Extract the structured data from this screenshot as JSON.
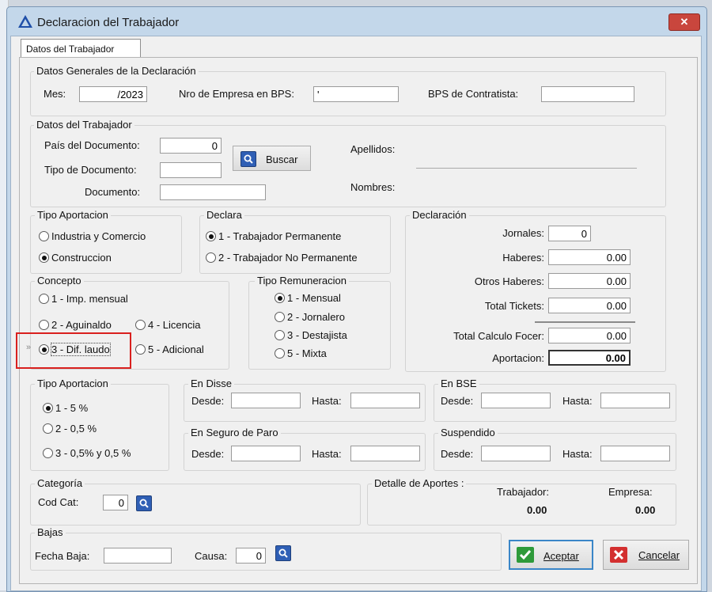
{
  "window": {
    "title": "Declaracion del Trabajador",
    "close_glyph": "✕"
  },
  "tab": {
    "label": "Datos del Trabajador"
  },
  "generales": {
    "title": "Datos Generales de la Declaración",
    "mes_label": "Mes:",
    "mes_value": "/2023",
    "nro_empresa_label": "Nro de Empresa en BPS:",
    "nro_empresa_value": "'",
    "bps_contratista_label": "BPS de Contratista:",
    "bps_contratista_value": ""
  },
  "trabajador": {
    "title": "Datos del Trabajador",
    "pais_label": "País del Documento:",
    "pais_value": "0",
    "tipo_doc_label": "Tipo de Documento:",
    "tipo_doc_value": "",
    "documento_label": "Documento:",
    "documento_value": "",
    "buscar_label": "Buscar",
    "apellidos_label": "Apellidos:",
    "nombres_label": "Nombres:"
  },
  "tipo_aportacion_1": {
    "title": "Tipo Aportacion",
    "options": [
      "Industria y Comercio",
      "Construccion"
    ],
    "selected": 1
  },
  "declara": {
    "title": "Declara",
    "options": [
      "1 - Trabajador Permanente",
      "2 - Trabajador No Permanente"
    ],
    "selected": 0
  },
  "declaracion": {
    "title": "Declaración",
    "jornales_label": "Jornales:",
    "jornales_value": "0",
    "haberes_label": "Haberes:",
    "haberes_value": "0.00",
    "otros_haberes_label": "Otros Haberes:",
    "otros_haberes_value": "0.00",
    "total_tickets_label": "Total Tickets:",
    "total_tickets_value": "0.00",
    "total_calculo_label": "Total Calculo Focer:",
    "total_calculo_value": "0.00",
    "aportacion_label": "Aportacion:",
    "aportacion_value": "0.00"
  },
  "concepto": {
    "title": "Concepto",
    "options": [
      "1 - Imp. mensual",
      "2 - Aguinaldo",
      "3 - Dif. laudo",
      "4 - Licencia",
      "5 - Adicional"
    ],
    "selected": 2,
    "arrow_marker": "»"
  },
  "tipo_remuneracion": {
    "title": "Tipo Remuneracion",
    "options": [
      "1 - Mensual",
      "2 - Jornalero",
      "3 - Destajista",
      "5 - Mixta"
    ],
    "selected": 0
  },
  "tipo_aportacion_2": {
    "title": "Tipo Aportacion",
    "options": [
      "1 - 5 %",
      "2 - 0,5 %",
      "3 - 0,5% y 0,5 %"
    ],
    "selected": 0
  },
  "en_disse": {
    "title": "En Disse",
    "desde_label": "Desde:",
    "hasta_label": "Hasta:",
    "desde_value": "",
    "hasta_value": ""
  },
  "en_bse": {
    "title": "En BSE",
    "desde_label": "Desde:",
    "hasta_label": "Hasta:",
    "desde_value": "",
    "hasta_value": ""
  },
  "seguro_paro": {
    "title": "En Seguro de Paro",
    "desde_label": "Desde:",
    "hasta_label": "Hasta:",
    "desde_value": "",
    "hasta_value": ""
  },
  "suspendido": {
    "title": "Suspendido",
    "desde_label": "Desde:",
    "hasta_label": "Hasta:",
    "desde_value": "",
    "hasta_value": ""
  },
  "categoria": {
    "title": "Categoría",
    "cod_cat_label": "Cod Cat:",
    "cod_cat_value": "0"
  },
  "detalle_aportes": {
    "title": "Detalle de Aportes :",
    "trabajador_label": "Trabajador:",
    "trabajador_value": "0.00",
    "empresa_label": "Empresa:",
    "empresa_value": "0.00"
  },
  "bajas": {
    "title": "Bajas",
    "fecha_baja_label": "Fecha Baja:",
    "fecha_baja_value": "",
    "causa_label": "Causa:",
    "causa_value": "0"
  },
  "buttons": {
    "aceptar": "Aceptar",
    "cancelar": "Cancelar"
  },
  "icons": {
    "search": "search-icon",
    "check": "check-icon",
    "cancel": "cancel-x-icon",
    "app": "triangle-app-icon"
  },
  "colors": {
    "titlebar": "#c3d7ea",
    "close_button": "#c9463d",
    "highlight": "#d9201e",
    "search_button": "#2f5fb5",
    "aceptar_icon": "#2e9a3a",
    "cancelar_icon": "#d32f2f"
  }
}
